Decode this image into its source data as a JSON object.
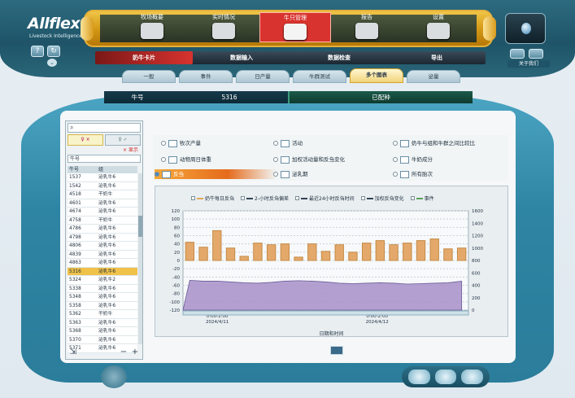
{
  "brand": {
    "name": "Allflex",
    "tagline": "Livestock Intelligence"
  },
  "top_menu": [
    {
      "label": "牧场概要",
      "active": false
    },
    {
      "label": "实时情况",
      "active": false
    },
    {
      "label": "牛只管理",
      "active": true
    },
    {
      "label": "报告",
      "active": false
    },
    {
      "label": "设置",
      "active": false
    }
  ],
  "sub_menu": [
    {
      "label": "奶牛卡片",
      "active": true
    },
    {
      "label": "数据输入",
      "active": false
    },
    {
      "label": "数据检查",
      "active": false
    },
    {
      "label": "导出",
      "active": false
    }
  ],
  "about_label": "关于我们",
  "tabs": [
    {
      "label": "一般",
      "active": false
    },
    {
      "label": "事件",
      "active": false
    },
    {
      "label": "日产量",
      "active": false
    },
    {
      "label": "牛群测试",
      "active": false
    },
    {
      "label": "多个图表",
      "active": true
    },
    {
      "label": "泌量",
      "active": false
    }
  ],
  "animal": {
    "key_label": "牛号",
    "id": "5316",
    "status": "已配种"
  },
  "list": {
    "search_placeholder": "",
    "filter_a": "♀ ×",
    "filter_b": "♀ ✓",
    "clear_mark": "× 显示",
    "select_value": "牛号",
    "col_id": "牛号",
    "col_group": "组",
    "rows": [
      {
        "id": "1537",
        "group": "泌乳牛6"
      },
      {
        "id": "1542",
        "group": "泌乳牛6"
      },
      {
        "id": "4518",
        "group": "干奶牛"
      },
      {
        "id": "4601",
        "group": "泌乳牛6"
      },
      {
        "id": "4674",
        "group": "泌乳牛6"
      },
      {
        "id": "4758",
        "group": "干奶牛"
      },
      {
        "id": "4786",
        "group": "泌乳牛6"
      },
      {
        "id": "4798",
        "group": "泌乳牛6"
      },
      {
        "id": "4806",
        "group": "泌乳牛6"
      },
      {
        "id": "4839",
        "group": "泌乳牛6"
      },
      {
        "id": "4863",
        "group": "泌乳牛6"
      },
      {
        "id": "5316",
        "group": "泌乳牛6",
        "selected": true
      },
      {
        "id": "5324",
        "group": "泌乳牛2"
      },
      {
        "id": "5338",
        "group": "泌乳牛6"
      },
      {
        "id": "5348",
        "group": "泌乳牛6"
      },
      {
        "id": "5358",
        "group": "泌乳牛6"
      },
      {
        "id": "5362",
        "group": "干奶牛"
      },
      {
        "id": "5363",
        "group": "泌乳牛6"
      },
      {
        "id": "5368",
        "group": "泌乳牛6"
      },
      {
        "id": "5370",
        "group": "泌乳牛6"
      },
      {
        "id": "5371",
        "group": "泌乳牛6"
      }
    ]
  },
  "chart_options": [
    {
      "label": "牧次产量",
      "checked": false,
      "highlight": false
    },
    {
      "label": "活动",
      "checked": false,
      "highlight": false
    },
    {
      "label": "奶牛与组和牛群之间比较比",
      "checked": false,
      "highlight": false
    },
    {
      "label": "动物周日体重",
      "checked": false,
      "highlight": false
    },
    {
      "label": "加权活动量和反刍变化",
      "checked": false,
      "highlight": false
    },
    {
      "label": "牛奶成分",
      "checked": false,
      "highlight": false
    },
    {
      "label": "反刍",
      "checked": true,
      "highlight": true
    },
    {
      "label": "泌乳期",
      "checked": false,
      "highlight": false
    },
    {
      "label": "所有胎次",
      "checked": false,
      "highlight": false
    }
  ],
  "chart_legend": [
    {
      "label": "奶牛每日反刍",
      "color": "#e0a85a"
    },
    {
      "label": "2-小时反刍偏差",
      "color": "#334455"
    },
    {
      "label": "最近24小时反刍时间",
      "color": "#334455"
    },
    {
      "label": "加权反刍变化",
      "color": "#334455"
    },
    {
      "label": "事件",
      "color": "#5aa05a"
    }
  ],
  "chart_data": {
    "type": "bar",
    "xlabel": "日期和时间",
    "x_ticks": [
      "0:00-2:00\n2024/4/11",
      "0:00-2:00\n2024/4/12"
    ],
    "y_left_ticks": [
      120,
      100,
      80,
      60,
      40,
      20,
      0,
      -20,
      -40,
      -60,
      -80,
      -100,
      -120
    ],
    "y_right_ticks": [
      1600,
      1400,
      1200,
      1000,
      800,
      600,
      400,
      200,
      0
    ],
    "ylim_left": [
      -120,
      120
    ],
    "ylim_right": [
      0,
      1600
    ],
    "series": [
      {
        "name": "奶牛每日反刍",
        "values": [
          44,
          32,
          72,
          30,
          10,
          42,
          38,
          40,
          8,
          40,
          22,
          38,
          20,
          42,
          48,
          38,
          42,
          48,
          52,
          28,
          30
        ]
      },
      {
        "name": "加权反刍变化",
        "values": [
          -48,
          -50,
          -50,
          -52,
          -54,
          -55,
          -53,
          -50,
          -49,
          -50,
          -52,
          -55,
          -56,
          -55,
          -54,
          -55,
          -57,
          -56,
          -55,
          -54,
          -50
        ]
      }
    ],
    "colors": {
      "bar_fill": "#e4a96a",
      "bar_stroke": "#c48a47",
      "area_fill": "#a890c8",
      "area_stroke": "#6a5a9a"
    }
  }
}
